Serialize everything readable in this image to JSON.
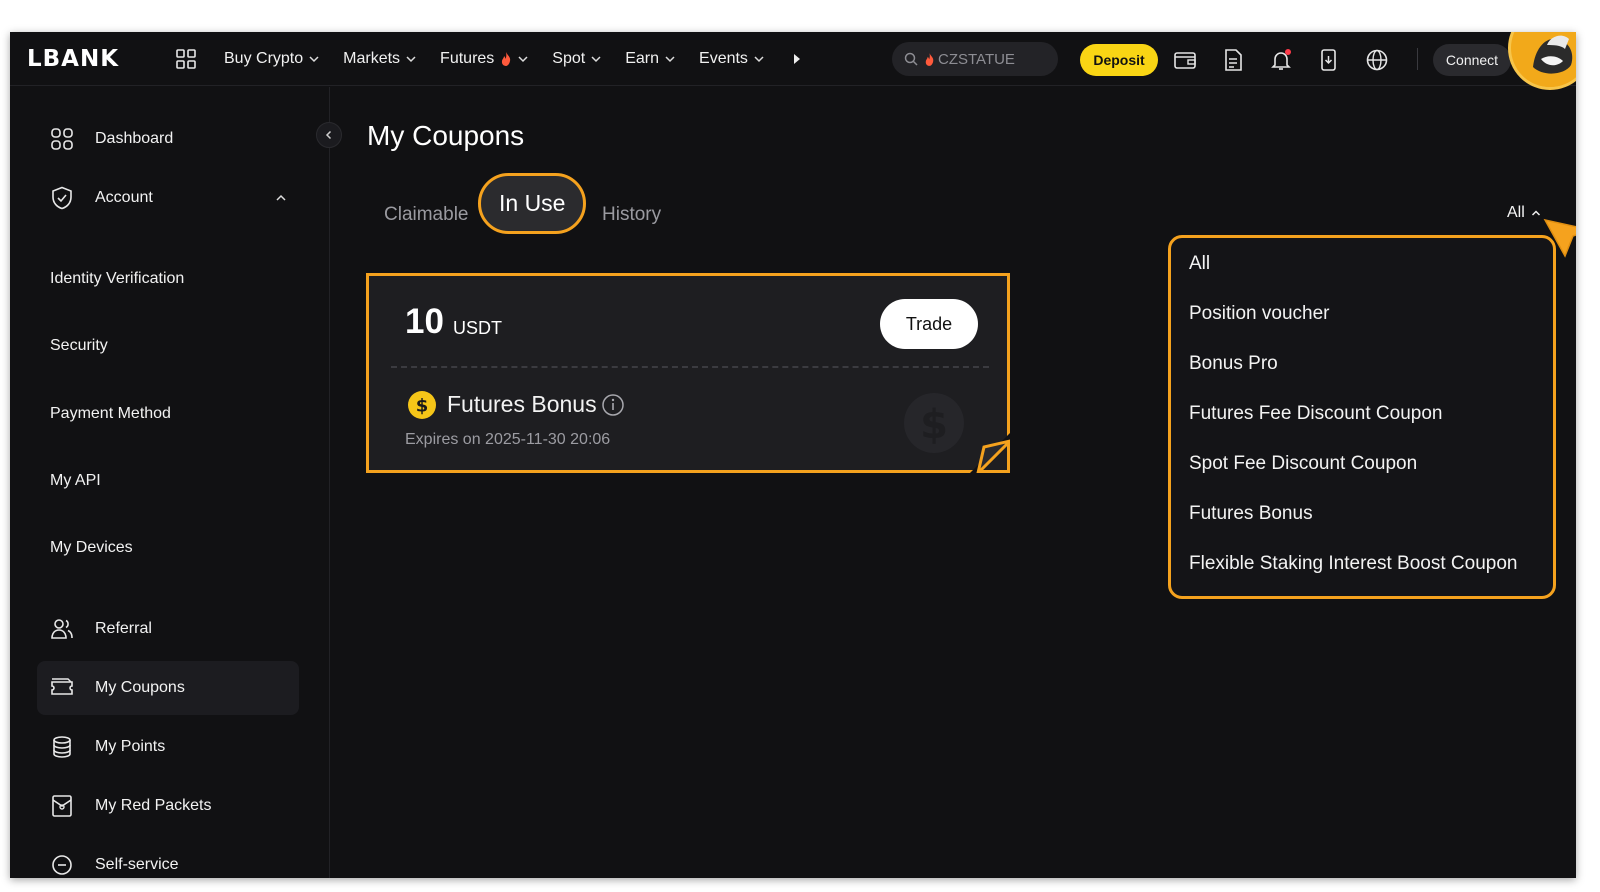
{
  "brand": {
    "logo": "LBANK"
  },
  "nav": {
    "items": [
      {
        "label": "Buy Crypto",
        "hot": false
      },
      {
        "label": "Markets",
        "hot": false
      },
      {
        "label": "Futures",
        "hot": true
      },
      {
        "label": "Spot",
        "hot": false
      },
      {
        "label": "Earn",
        "hot": false
      },
      {
        "label": "Events",
        "hot": false
      }
    ],
    "search_value": "CZSTATUE",
    "deposit_label": "Deposit",
    "connect_label": "Connect"
  },
  "sidebar": {
    "dashboard": "Dashboard",
    "account": "Account",
    "account_sub": [
      "Identity Verification",
      "Security",
      "Payment Method",
      "My API",
      "My Devices"
    ],
    "referral": "Referral",
    "my_coupons": "My Coupons",
    "my_points": "My Points",
    "my_red_packets": "My Red Packets",
    "self_service": "Self-service"
  },
  "main": {
    "title": "My Coupons",
    "tabs": [
      {
        "label": "Claimable",
        "active": false
      },
      {
        "label": "In Use",
        "active": true
      },
      {
        "label": "History",
        "active": false
      }
    ],
    "filter_label": "All",
    "coupon": {
      "amount": "10",
      "unit": "USDT",
      "trade_label": "Trade",
      "name": "Futures Bonus",
      "expires": "Expires on 2025-11-30 20:06"
    },
    "dropdown_options": [
      "All",
      "Position voucher",
      "Bonus Pro",
      "Futures Fee Discount Coupon",
      "Spot Fee Discount Coupon",
      "Futures Bonus",
      "Flexible Staking Interest Boost Coupon"
    ]
  },
  "colors": {
    "background": "#111113",
    "accent_highlight": "#f5a21e",
    "deposit_yellow": "#f9d514",
    "coin_yellow": "#f5c518"
  }
}
